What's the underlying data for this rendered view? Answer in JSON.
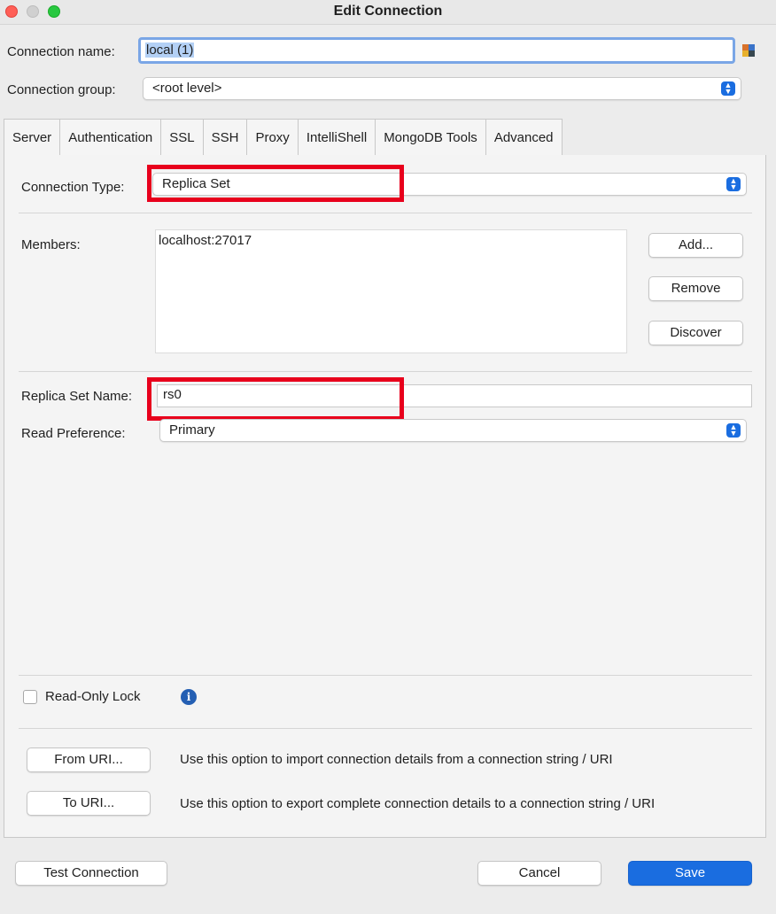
{
  "window": {
    "title": "Edit Connection"
  },
  "connection_name": {
    "label": "Connection name:",
    "value": "local (1)"
  },
  "connection_group": {
    "label": "Connection group:",
    "value": "<root level>"
  },
  "tabs": [
    {
      "label": "Server",
      "active": true
    },
    {
      "label": "Authentication"
    },
    {
      "label": "SSL"
    },
    {
      "label": "SSH"
    },
    {
      "label": "Proxy"
    },
    {
      "label": "IntelliShell"
    },
    {
      "label": "MongoDB Tools"
    },
    {
      "label": "Advanced"
    }
  ],
  "server": {
    "connection_type": {
      "label": "Connection Type:",
      "value": "Replica Set"
    },
    "members": {
      "label": "Members:",
      "items": [
        "localhost:27017"
      ]
    },
    "member_buttons": {
      "add": "Add...",
      "remove": "Remove",
      "discover": "Discover"
    },
    "replica_set_name": {
      "label": "Replica Set Name:",
      "value": "rs0"
    },
    "read_preference": {
      "label": "Read Preference:",
      "value": "Primary"
    },
    "read_only_lock": {
      "label": "Read-Only Lock",
      "checked": false
    },
    "uri": {
      "from_button": "From URI...",
      "from_desc": "Use this option to import connection details from a connection string / URI",
      "to_button": "To URI...",
      "to_desc": "Use this option to export complete connection details to a connection string / URI"
    }
  },
  "footer": {
    "test": "Test Connection",
    "cancel": "Cancel",
    "save": "Save"
  },
  "colors": {
    "accent": "#1a6de0",
    "highlight_box": "#e8001c"
  }
}
